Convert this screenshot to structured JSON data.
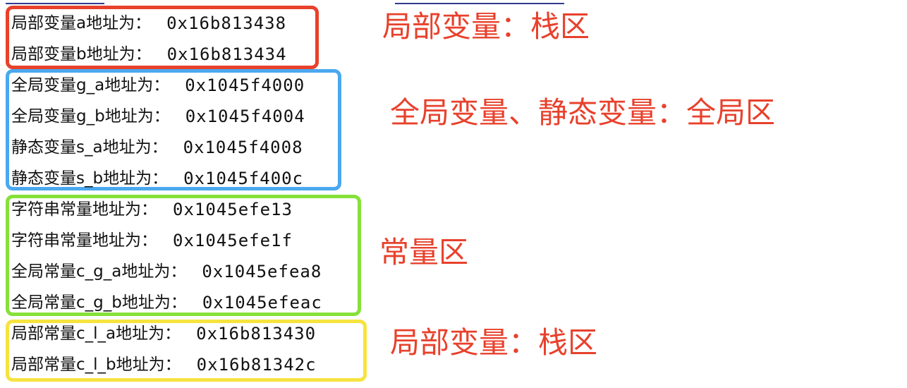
{
  "colors": {
    "annotation_red": "#e8412c",
    "stack_box": "#e8412c",
    "global_box": "#4aa8ef",
    "const_box": "#86e03a",
    "local_const_box": "#f6e340",
    "text": "#111111"
  },
  "groups": [
    {
      "id": "stack-locals",
      "lines": [
        {
          "label": "局部变量a地址为：",
          "addr": "0x16b813438"
        },
        {
          "label": "局部变量b地址为：",
          "addr": "0x16b813434"
        }
      ],
      "annotation": "局部变量：栈区"
    },
    {
      "id": "globals-statics",
      "lines": [
        {
          "label": "全局变量g_a地址为：",
          "addr": "0x1045f4000"
        },
        {
          "label": "全局变量g_b地址为：",
          "addr": "0x1045f4004"
        },
        {
          "label": "静态变量s_a地址为：",
          "addr": "0x1045f4008"
        },
        {
          "label": "静态变量s_b地址为：",
          "addr": "0x1045f400c"
        }
      ],
      "annotation": "全局变量、静态变量：全局区"
    },
    {
      "id": "constants",
      "lines": [
        {
          "label": "字符串常量地址为：",
          "addr": "0x1045efe13"
        },
        {
          "label": "字符串常量地址为：",
          "addr": "0x1045efe1f"
        },
        {
          "label": "全局常量c_g_a地址为：",
          "addr": "0x1045efea8"
        },
        {
          "label": "全局常量c_g_b地址为：",
          "addr": "0x1045efeac"
        }
      ],
      "annotation": "常量区"
    },
    {
      "id": "local-constants",
      "lines": [
        {
          "label": "局部常量c_l_a地址为：",
          "addr": "0x16b813430"
        },
        {
          "label": "局部常量c_l_b地址为：",
          "addr": "0x16b81342c"
        }
      ],
      "annotation": "局部变量：栈区"
    }
  ]
}
